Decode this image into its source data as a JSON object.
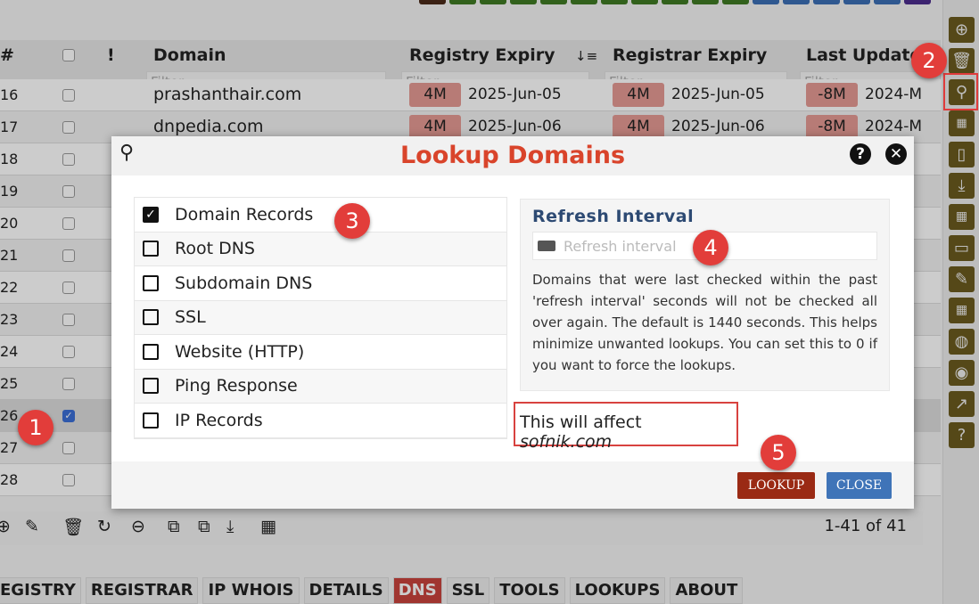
{
  "top_strip_colors": [
    "#4a2a1a",
    "#3f7a24",
    "#3f7a24",
    "#3f7a24",
    "#3f7a24",
    "#3f7a24",
    "#3f7a24",
    "#3f7a24",
    "#3f7a24",
    "#3f7a24",
    "#3f7a24",
    "#3b6fb5",
    "#3b6fb5",
    "#3b6fb5",
    "#3b6fb5",
    "#3b6fb5",
    "#4c2c8c"
  ],
  "table": {
    "columns": [
      "#",
      "!",
      "Domain",
      "Registry Expiry",
      "Registrar Expiry",
      "Last Update"
    ],
    "filter_placeholder": "Filter",
    "rows": [
      {
        "n": "16",
        "domain": "prashanthair.com",
        "reg_badge": "4M",
        "reg_date": "2025-Jun-05",
        "rar_badge": "4M",
        "rar_date": "2025-Jun-05",
        "upd_badge": "-8M",
        "upd_date": "2024-M",
        "checked": false
      },
      {
        "n": "17",
        "domain": "dnpedia.com",
        "reg_badge": "4M",
        "reg_date": "2025-Jun-06",
        "rar_badge": "4M",
        "rar_date": "2025-Jun-06",
        "upd_badge": "-8M",
        "upd_date": "2024-M",
        "checked": false
      },
      {
        "n": "18",
        "checked": false
      },
      {
        "n": "19",
        "checked": false
      },
      {
        "n": "20",
        "checked": false
      },
      {
        "n": "21",
        "checked": false
      },
      {
        "n": "22",
        "checked": false
      },
      {
        "n": "23",
        "checked": false
      },
      {
        "n": "24",
        "checked": false
      },
      {
        "n": "25",
        "checked": false
      },
      {
        "n": "26",
        "checked": true
      },
      {
        "n": "27",
        "checked": false
      },
      {
        "n": "28",
        "checked": false
      }
    ]
  },
  "pager": "1-41 of 41",
  "tabs": [
    {
      "label": "EGISTRY"
    },
    {
      "label": "REGISTRAR"
    },
    {
      "label": "IP WHOIS"
    },
    {
      "label": "DETAILS"
    },
    {
      "label": "DNS",
      "active": true
    },
    {
      "label": "SSL"
    },
    {
      "label": "TOOLS"
    },
    {
      "label": "LOOKUPS"
    },
    {
      "label": "ABOUT"
    }
  ],
  "modal": {
    "title": "Lookup Domains",
    "options": [
      {
        "label": "Domain Records",
        "checked": true
      },
      {
        "label": "Root DNS",
        "checked": false
      },
      {
        "label": "Subdomain DNS",
        "checked": false
      },
      {
        "label": "SSL",
        "checked": false
      },
      {
        "label": "Website (HTTP)",
        "checked": false
      },
      {
        "label": "Ping Response",
        "checked": false
      },
      {
        "label": "IP Records",
        "checked": false
      }
    ],
    "refresh_title": "Refresh Interval",
    "refresh_placeholder": "Refresh interval",
    "refresh_desc": "Domains that were last checked within the past 'refresh interval' seconds will not be checked all over again. The default is 1440 seconds. This helps minimize unwanted lookups. You can set this to 0 if you want to force the lookups.",
    "affect_prefix": "This will affect ",
    "affect_domain": "sofnik.com",
    "lookup_label": "LOOKUP",
    "close_label": "CLOSE",
    "help": "?",
    "x": "✕"
  },
  "annotations": [
    "1",
    "2",
    "3",
    "4",
    "5"
  ]
}
